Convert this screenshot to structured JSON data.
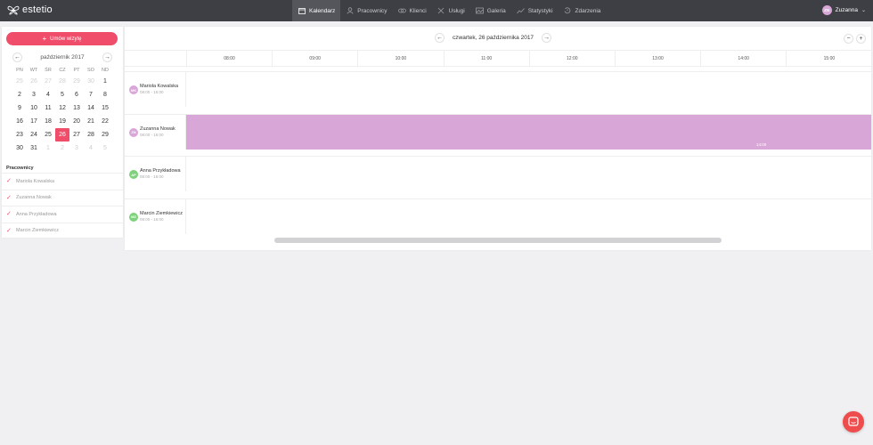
{
  "app": {
    "brand": "estetio"
  },
  "nav": [
    {
      "label": "Kalendarz",
      "icon": "calendar-icon",
      "active": true
    },
    {
      "label": "Pracownicy",
      "icon": "user-icon",
      "active": false
    },
    {
      "label": "Klienci",
      "icon": "clients-icon",
      "active": false
    },
    {
      "label": "Usługi",
      "icon": "scissors-icon",
      "active": false
    },
    {
      "label": "Galeria",
      "icon": "gallery-icon",
      "active": false
    },
    {
      "label": "Statystyki",
      "icon": "chart-icon",
      "active": false
    },
    {
      "label": "Zdarzenia",
      "icon": "history-icon",
      "active": false
    }
  ],
  "user": {
    "initials": "ZN",
    "name": "Zuzanna"
  },
  "sidebar": {
    "book_label": "Umów wizytę",
    "calendar": {
      "month_label": "październik 2017",
      "weekdays": [
        "PN",
        "WT",
        "ŚR",
        "CZ",
        "PT",
        "SO",
        "ND"
      ],
      "days": [
        {
          "d": "25",
          "m": true
        },
        {
          "d": "26",
          "m": true
        },
        {
          "d": "27",
          "m": true
        },
        {
          "d": "28",
          "m": true
        },
        {
          "d": "29",
          "m": true
        },
        {
          "d": "30",
          "m": true
        },
        {
          "d": "1",
          "m": false
        },
        {
          "d": "2",
          "m": false
        },
        {
          "d": "3",
          "m": false
        },
        {
          "d": "4",
          "m": false
        },
        {
          "d": "5",
          "m": false
        },
        {
          "d": "6",
          "m": false
        },
        {
          "d": "7",
          "m": false
        },
        {
          "d": "8",
          "m": false
        },
        {
          "d": "9",
          "m": false
        },
        {
          "d": "10",
          "m": false
        },
        {
          "d": "11",
          "m": false
        },
        {
          "d": "12",
          "m": false
        },
        {
          "d": "13",
          "m": false
        },
        {
          "d": "14",
          "m": false
        },
        {
          "d": "15",
          "m": false
        },
        {
          "d": "16",
          "m": false
        },
        {
          "d": "17",
          "m": false
        },
        {
          "d": "18",
          "m": false
        },
        {
          "d": "19",
          "m": false
        },
        {
          "d": "20",
          "m": false
        },
        {
          "d": "21",
          "m": false
        },
        {
          "d": "22",
          "m": false
        },
        {
          "d": "23",
          "m": false
        },
        {
          "d": "24",
          "m": false
        },
        {
          "d": "25",
          "m": false
        },
        {
          "d": "26",
          "m": false,
          "today": true
        },
        {
          "d": "27",
          "m": false
        },
        {
          "d": "28",
          "m": false
        },
        {
          "d": "29",
          "m": false
        },
        {
          "d": "30",
          "m": false
        },
        {
          "d": "31",
          "m": false
        },
        {
          "d": "1",
          "m": true
        },
        {
          "d": "2",
          "m": true
        },
        {
          "d": "3",
          "m": true
        },
        {
          "d": "4",
          "m": true
        },
        {
          "d": "5",
          "m": true
        }
      ]
    },
    "employees_title": "Pracownicy",
    "employees": [
      "Mariola Kowalska",
      "Zuzanna Nowak",
      "Anna Przykładowa",
      "Marcin Ziemkiewicz"
    ]
  },
  "schedule": {
    "date_label": "czwartek, 26 października 2017",
    "hours": [
      "08:00",
      "09:00",
      "10:00",
      "11:00",
      "12:00",
      "13:00",
      "14:00",
      "15:00"
    ],
    "rows": [
      {
        "initials": "MK",
        "name": "Mariola Kowalska",
        "hours": "08:00 - 16:00",
        "color": "#d9a6d8",
        "block": false
      },
      {
        "initials": "ZN",
        "name": "Zuzanna Nowak",
        "hours": "08:00 - 16:00",
        "color": "#d9a6d8",
        "block": true,
        "block_label": "14:00"
      },
      {
        "initials": "AP",
        "name": "Anna Przykładowa",
        "hours": "08:00 - 16:00",
        "color": "#7dd27b",
        "block": false
      },
      {
        "initials": "MZ",
        "name": "Marcin Ziemkiewicz",
        "hours": "08:00 - 16:00",
        "color": "#7dd27b",
        "block": false
      }
    ]
  },
  "colors": {
    "accent": "#ef4d6a",
    "topbar": "#3d3f45",
    "shift": "#d9a6d8",
    "chat": "#ef4d4d"
  }
}
